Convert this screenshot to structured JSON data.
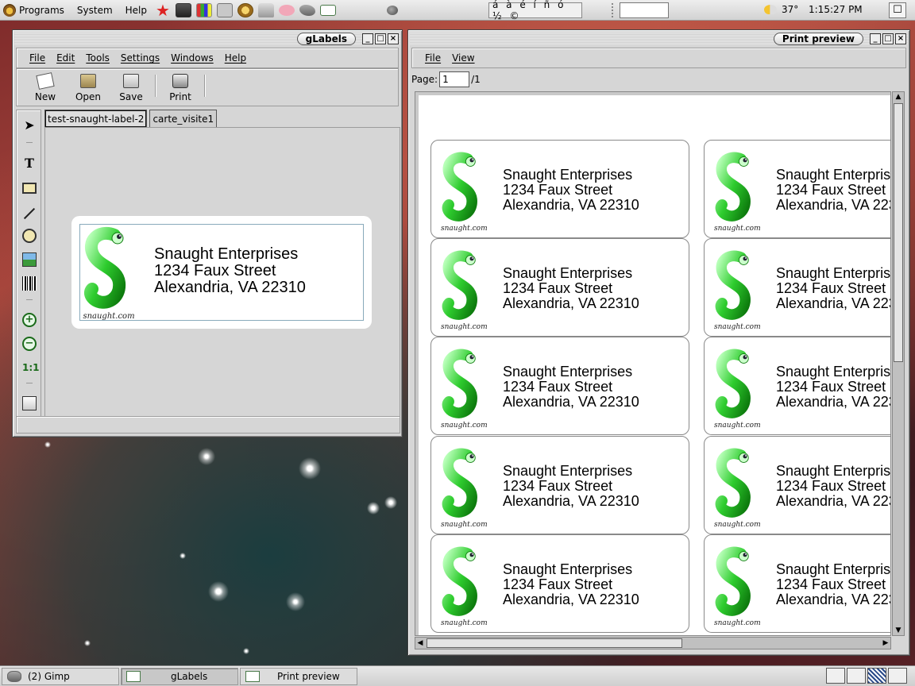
{
  "top_panel": {
    "menus": [
      "Programs",
      "System",
      "Help"
    ],
    "launchers": [
      "star-icon",
      "terminal-icon",
      "chart-icon",
      "book-icon",
      "globe-icon",
      "cup-icon",
      "pig-icon",
      "gimp-icon",
      "label-icon"
    ],
    "char_palette": "á à é í ñ ó ½ ©",
    "weather": "37°",
    "clock": "1:15:27 PM"
  },
  "glabels": {
    "title": "gLabels",
    "menu": [
      "File",
      "Edit",
      "Tools",
      "Settings",
      "Windows",
      "Help"
    ],
    "toolbar": {
      "new": "New",
      "open": "Open",
      "save": "Save",
      "print": "Print"
    },
    "tabs": [
      "test-snaught-label-2",
      "carte_visite1"
    ],
    "label": {
      "line1": "Snaught Enterprises",
      "line2": "1234 Faux Street",
      "line3": "Alexandria, VA 22310",
      "logo_caption": "snaught.com"
    }
  },
  "preview": {
    "title": "Print preview",
    "menu": [
      "File",
      "View"
    ],
    "page_label": "Page:",
    "page_value": "1",
    "page_total": "/1",
    "label": {
      "line1": "Snaught Enterprises",
      "line2": "1234 Faux Street",
      "line3": "Alexandria, VA 22310",
      "logo_caption": "snaught.com"
    }
  },
  "taskbar": {
    "tasks": [
      "(2) Gimp",
      "gLabels",
      "Print preview"
    ]
  },
  "colors": {
    "logo_green": "#2ecc2e",
    "window_bg": "#d6d6d6"
  }
}
